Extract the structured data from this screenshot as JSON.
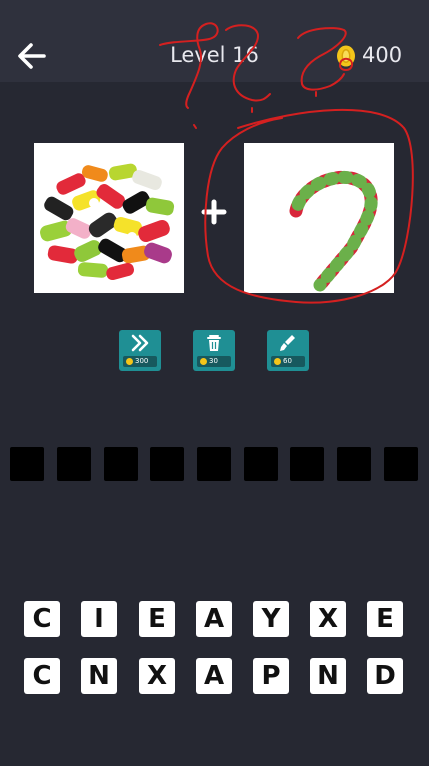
{
  "header": {
    "title": "Level 16",
    "coins": "400",
    "back_icon": "arrow-left-icon",
    "coin_icon": "coin-icon"
  },
  "puzzle": {
    "images": [
      {
        "subject": "pile of colorful licorice candies"
      },
      {
        "subject": "red, white and green candy cane"
      }
    ],
    "operator": "+"
  },
  "hints": [
    {
      "icon": "skip-icon",
      "cost": "300"
    },
    {
      "icon": "trash-icon",
      "cost": "30"
    },
    {
      "icon": "brush-icon",
      "cost": "60"
    }
  ],
  "answer": {
    "slots": 9
  },
  "keyboard": {
    "row1": [
      "C",
      "I",
      "E",
      "A",
      "Y",
      "X",
      "E"
    ],
    "row2": [
      "C",
      "N",
      "X",
      "A",
      "P",
      "N",
      "D"
    ]
  },
  "colors": {
    "background": "#262832",
    "topbar": "#2f313d",
    "hint_button": "#1f8f94",
    "annotation": "#d42020"
  }
}
